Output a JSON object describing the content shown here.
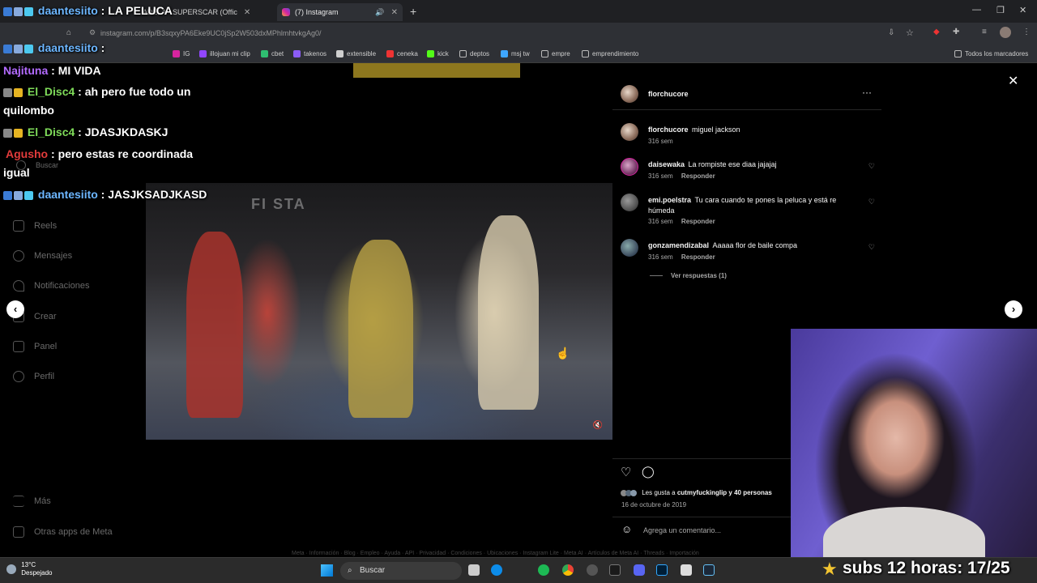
{
  "browser": {
    "tabs": [
      {
        "label": "ADÉLA - SUPERSCAR (Offic"
      },
      {
        "label": "(7) Instagram"
      }
    ],
    "url": "instagram.com/p/B3sqxyPA6Eke9UC0jSp2W503dxMPhlmhtvkgAg0/",
    "bookmarks": [
      "IG",
      "illojuan mi clip",
      "cbet",
      "takenos",
      "extensible",
      "ceneka",
      "kick",
      "deptos",
      "msj tw",
      "empre",
      "emprendimiento"
    ],
    "all_bookmarks": "Todos los marcadores"
  },
  "chat": [
    {
      "user": "daantesiito",
      "sep": " : ",
      "msg": "LA PELUCA",
      "color": "#6cb6ff"
    },
    {
      "user": "daantesiito",
      "sep": " :",
      "msg": "",
      "color": "#6cb6ff"
    },
    {
      "user": "Najituna",
      "sep": " : ",
      "msg": "MI VIDA",
      "color": "#b36bff"
    },
    {
      "user": "El_Disc4",
      "sep": " : ",
      "msg": "ah pero fue todo un",
      "color": "#7fdc5a"
    },
    {
      "user": "",
      "sep": "",
      "msg": "quilombo",
      "color": "#ffffff"
    },
    {
      "user": "El_Disc4",
      "sep": " : ",
      "msg": "JDASJKDASKJ",
      "color": "#7fdc5a"
    },
    {
      "user": "Agusho",
      "sep": " : ",
      "msg": "pero estas re coordinada",
      "color": "#e23b3b"
    },
    {
      "user": "",
      "sep": "",
      "msg": "igual",
      "color": "#ffffff"
    },
    {
      "user": "daantesiito",
      "sep": " : ",
      "msg": "JASJKSADJKASD",
      "color": "#6cb6ff"
    }
  ],
  "sidebar": {
    "items": [
      {
        "label": "Buscar"
      },
      {
        "label": "Reels"
      },
      {
        "label": "Mensajes"
      },
      {
        "label": "Notificaciones"
      },
      {
        "label": "Crear"
      },
      {
        "label": "Panel"
      },
      {
        "label": "Perfil"
      },
      {
        "label": "Más"
      },
      {
        "label": "Otras apps de Meta"
      }
    ]
  },
  "video": {
    "overlay_text": "FI STA"
  },
  "post": {
    "author": "florchucore",
    "caption_user": "florchucore",
    "caption_text": "miguel jackson",
    "caption_time": "316 sem",
    "comments": [
      {
        "user": "daisewaka",
        "text": "La rompiste ese diaa jajajaj",
        "time": "316 sem",
        "reply": "Responder"
      },
      {
        "user": "emi.poelstra",
        "text": "Tu cara cuando te pones la peluca y está re húmeda",
        "time": "316 sem",
        "reply": "Responder"
      },
      {
        "user": "gonzamendizabal",
        "text": "Aaaaa flor de baile compa",
        "time": "316 sem",
        "reply": "Responder"
      }
    ],
    "view_replies": "Ver respuestas (1)",
    "likes_prefix": "Les gusta a",
    "likes_user": "cutmyfuckinglip",
    "likes_suffix": "y 40 personas",
    "date": "16 de octubre de 2019",
    "add_comment": "Agrega un comentario...",
    "footer_links": "Meta · Información · Blog · Empleo · Ayuda · API · Privacidad · Condiciones · Ubicaciones · Instagram Lite · Meta AI · Artículos de Meta AI · Threads · Importación"
  },
  "stream": {
    "subs_label": "subs 12 horas: 17/25"
  },
  "taskbar": {
    "temp": "13°C",
    "weather": "Despejado",
    "search": "Buscar"
  }
}
